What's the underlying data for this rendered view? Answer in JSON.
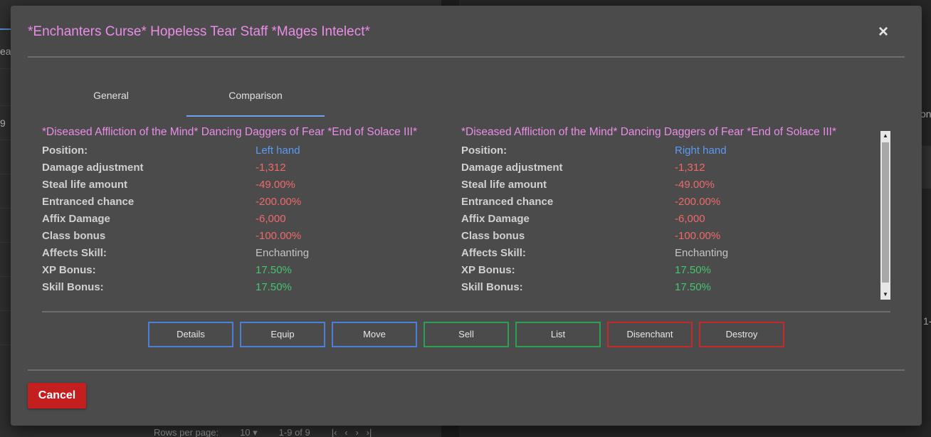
{
  "background": {
    "left_fragments": [
      "ea",
      "9"
    ],
    "right_fragments": [
      "on",
      "1-"
    ],
    "footer": {
      "rows_per_page_label": "Rows per page:",
      "rows_per_page_value": "10",
      "range": "1-9 of 9"
    }
  },
  "dialog": {
    "title": "*Enchanters Curse* Hopeless Tear Staff *Mages Intelect*",
    "close_icon": "×"
  },
  "tabs": [
    {
      "label": "General",
      "active": false
    },
    {
      "label": "Comparison",
      "active": true
    }
  ],
  "comparison": {
    "left": {
      "name": "*Diseased Affliction of the Mind* Dancing Daggers of Fear *End of Solace III*",
      "stats": [
        {
          "label": "Position:",
          "value": "Left hand"
        },
        {
          "label": "Damage adjustment",
          "value": "-1,312"
        },
        {
          "label": "Steal life amount",
          "value": "-49.00%"
        },
        {
          "label": "Entranced chance",
          "value": "-200.00%"
        },
        {
          "label": "Affix Damage",
          "value": "-6,000"
        },
        {
          "label": "Class bonus",
          "value": "-100.00%"
        },
        {
          "label": "Affects Skill:",
          "value": "Enchanting"
        },
        {
          "label": "XP Bonus:",
          "value": "17.50%"
        },
        {
          "label": "Skill Bonus:",
          "value": "17.50%"
        }
      ]
    },
    "right": {
      "name": "*Diseased Affliction of the Mind* Dancing Daggers of Fear *End of Solace III*",
      "stats": [
        {
          "label": "Position:",
          "value": "Right hand"
        },
        {
          "label": "Damage adjustment",
          "value": "-1,312"
        },
        {
          "label": "Steal life amount",
          "value": "-49.00%"
        },
        {
          "label": "Entranced chance",
          "value": "-200.00%"
        },
        {
          "label": "Affix Damage",
          "value": "-6,000"
        },
        {
          "label": "Class bonus",
          "value": "-100.00%"
        },
        {
          "label": "Affects Skill:",
          "value": "Enchanting"
        },
        {
          "label": "XP Bonus:",
          "value": "17.50%"
        },
        {
          "label": "Skill Bonus:",
          "value": "17.50%"
        }
      ]
    }
  },
  "actions": {
    "details": "Details",
    "equip": "Equip",
    "move": "Move",
    "sell": "Sell",
    "list": "List",
    "disenchant": "Disenchant",
    "destroy": "Destroy"
  },
  "cancel_label": "Cancel",
  "colors": {
    "title": "#e98de6",
    "position": "#5b9af2",
    "negative": "#ee6a6a",
    "positive": "#46c46e",
    "tab_underline": "#6ea3ef",
    "cancel": "#c41f1f"
  }
}
